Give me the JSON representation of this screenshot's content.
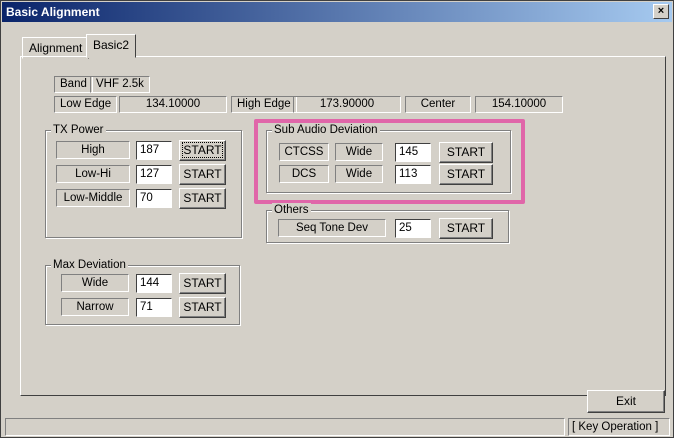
{
  "window": {
    "title": "Basic Alignment",
    "close_glyph": "×"
  },
  "tabs": [
    {
      "label": "Alignment"
    },
    {
      "label": "Basic2"
    }
  ],
  "band": {
    "label": "Band",
    "value": "VHF 2.5k",
    "low_edge_label": "Low Edge",
    "low_edge_value": "134.10000",
    "high_edge_label": "High Edge",
    "high_edge_value": "173.90000",
    "center_label": "Center",
    "center_value": "154.10000"
  },
  "tx_power": {
    "title": "TX Power",
    "rows": [
      {
        "label": "High",
        "value": "187",
        "button": "START"
      },
      {
        "label": "Low-Hi",
        "value": "127",
        "button": "START"
      },
      {
        "label": "Low-Middle",
        "value": "70",
        "button": "START"
      }
    ]
  },
  "sub_audio": {
    "title": "Sub Audio Deviation",
    "rows": [
      {
        "label": "CTCSS",
        "mode": "Wide",
        "value": "145",
        "button": "START"
      },
      {
        "label": "DCS",
        "mode": "Wide",
        "value": "113",
        "button": "START"
      }
    ],
    "highlight_color": "#e066a9"
  },
  "others": {
    "title": "Others",
    "rows": [
      {
        "label": "Seq Tone Dev",
        "value": "25",
        "button": "START"
      }
    ]
  },
  "max_deviation": {
    "title": "Max Deviation",
    "rows": [
      {
        "label": "Wide",
        "value": "144",
        "button": "START"
      },
      {
        "label": "Narrow",
        "value": "71",
        "button": "START"
      }
    ]
  },
  "footer": {
    "exit_label": "Exit",
    "status_text": "[ Key Operation ]"
  },
  "colors": {
    "window_bg": "#d4d0c8",
    "title_start": "#0a246a",
    "title_end": "#a6caf0"
  }
}
